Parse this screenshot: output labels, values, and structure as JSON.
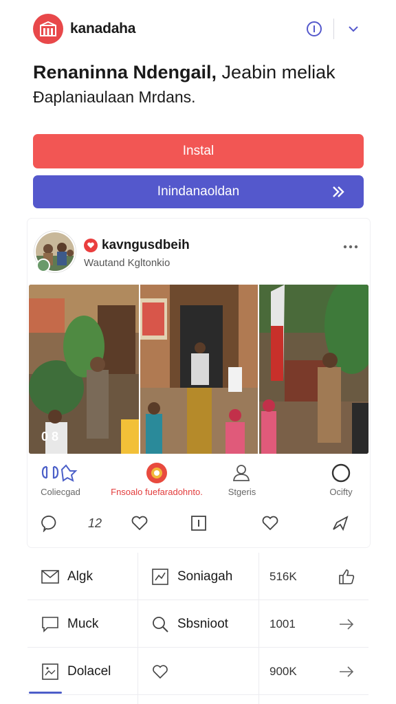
{
  "app": {
    "name": "kanadaha",
    "icon": "store-icon",
    "brand_color": "#e8484a",
    "accent_color": "#5458cc",
    "actions": [
      {
        "name": "info-icon"
      },
      {
        "name": "chevron-down-icon"
      }
    ]
  },
  "headline": {
    "line1_bold": "Renaninna Ndengail,",
    "line1_tail": " Jeabin meliak",
    "line2": "Ðaplaniaulaan Mrdans."
  },
  "buttons": {
    "install": "Instal",
    "secondary": "Inindanaoldan"
  },
  "post": {
    "username": "kavngusdbeih",
    "subtitle": "Wautand Kgltonkio",
    "photo_counter": "0 8",
    "actions": [
      {
        "label": "Coliecgad",
        "icon": "quote-share-icon"
      },
      {
        "label": "Fnsoalo fuefaradohnto.",
        "icon": "sticker-icon"
      },
      {
        "label": "Stgeris",
        "icon": "users-icon"
      },
      {
        "label": "Ocifty",
        "icon": "circle-icon"
      }
    ],
    "reactions": [
      {
        "name": "comment-icon"
      },
      {
        "name": "edit-count-icon",
        "label": "12"
      },
      {
        "name": "heart-icon"
      },
      {
        "name": "bookmark-icon"
      },
      {
        "name": "heart-outline-icon"
      },
      {
        "name": "share-icon"
      }
    ]
  },
  "list": [
    {
      "c1": "Algk",
      "c1_icon": "mail-icon",
      "c2": "Soniagah",
      "c2_icon": "chart-icon",
      "c3": "516K",
      "c4_icon": "thumb-icon"
    },
    {
      "c1": "Muck",
      "c1_icon": "message-icon",
      "c2": "Sbsnioot",
      "c2_icon": "search-icon",
      "c3": "1001",
      "c4_icon": "arrow-right-icon"
    },
    {
      "c1": "Dolacel",
      "c1_icon": "image-icon",
      "c2": "",
      "c2_icon": "heart-icon",
      "c3": "900K",
      "c4_icon": "arrow-right-icon"
    }
  ]
}
